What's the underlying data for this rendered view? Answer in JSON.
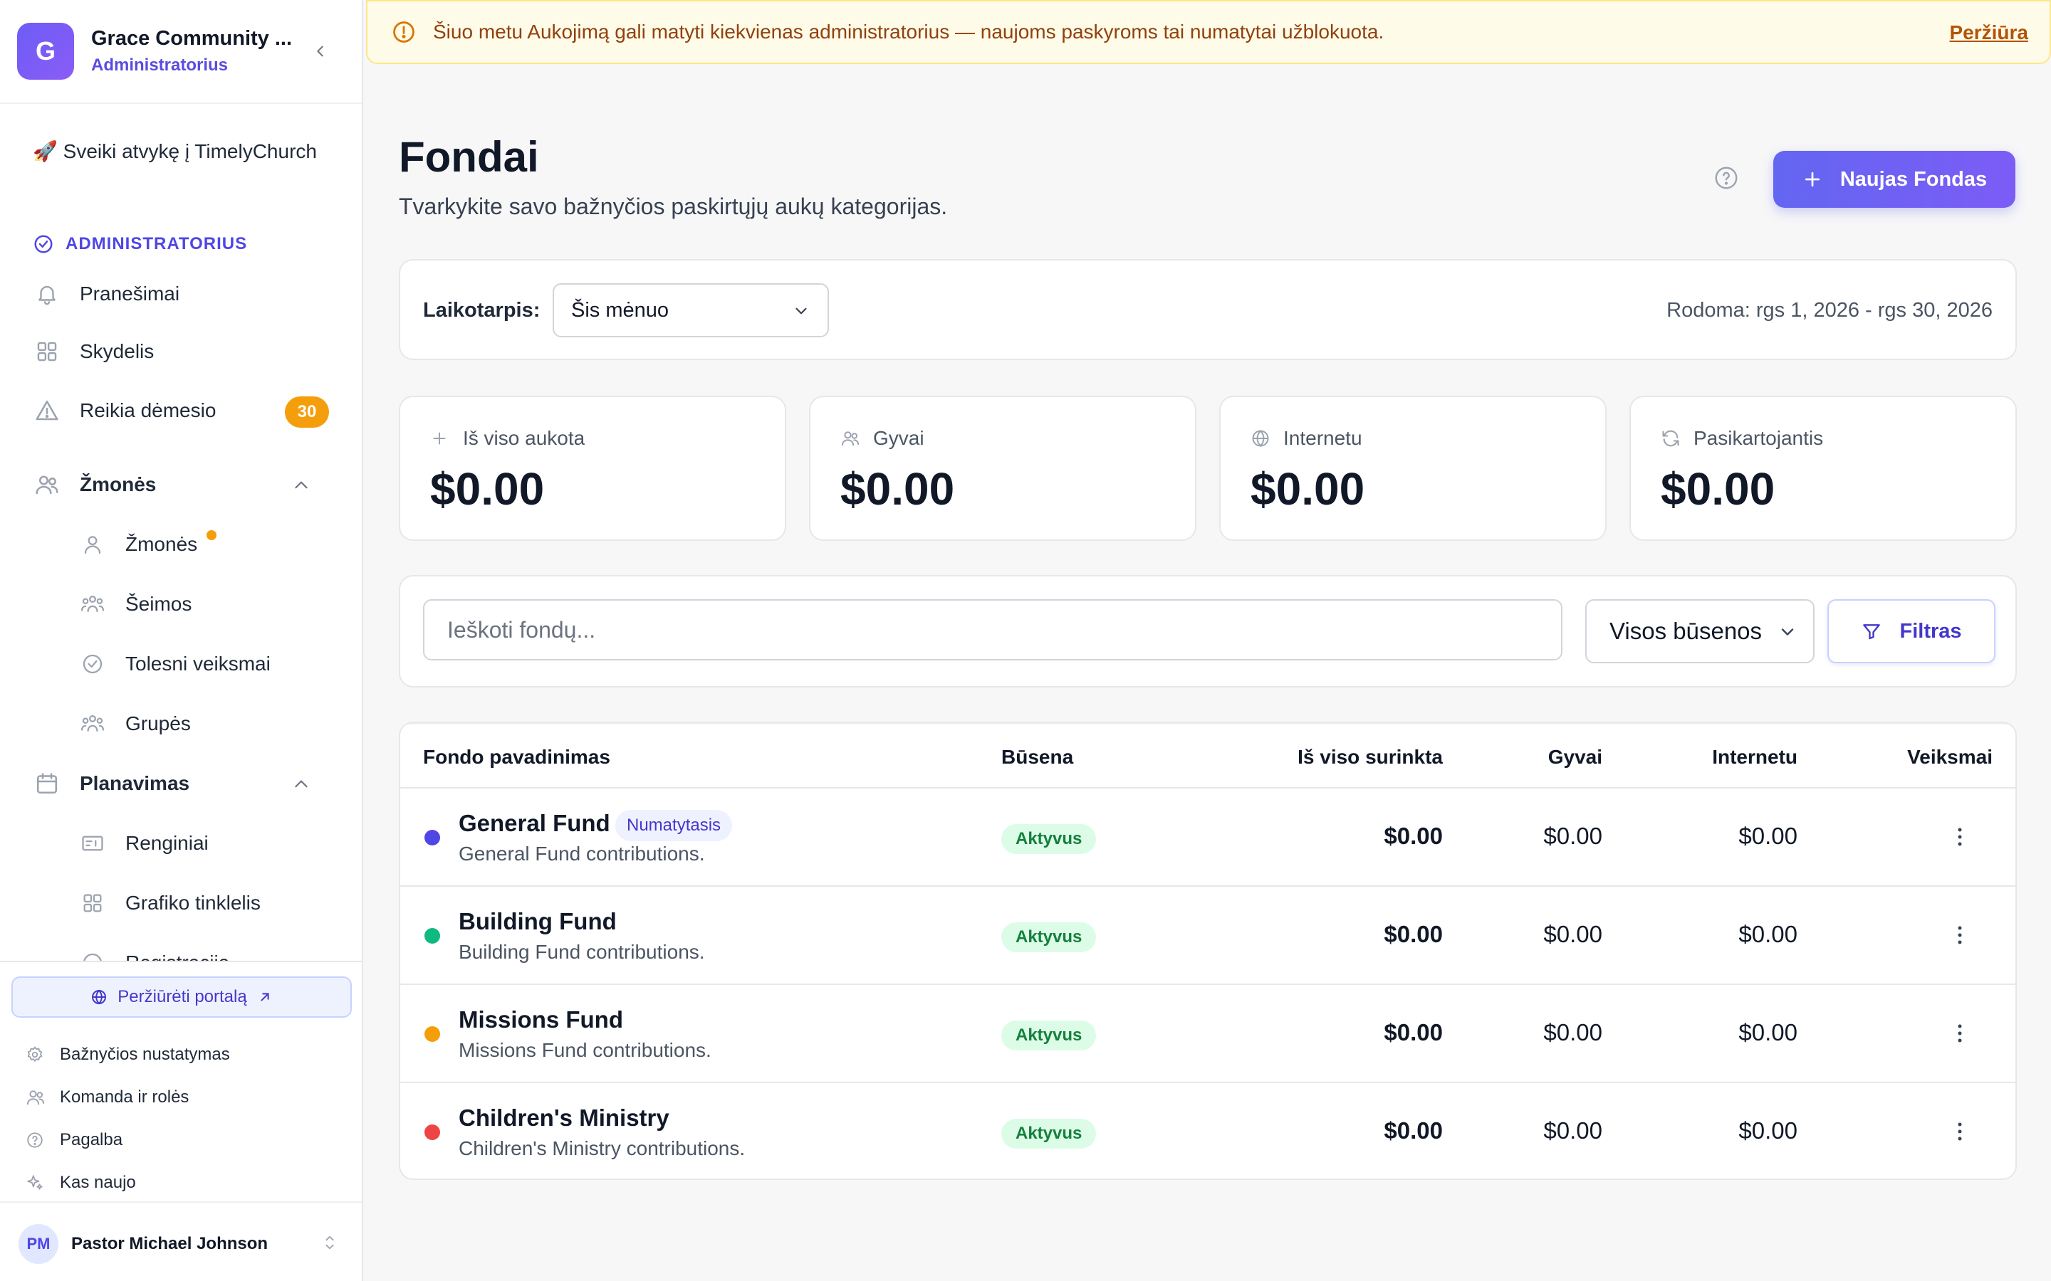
{
  "org": {
    "initial": "G",
    "name": "Grace Community ...",
    "role": "Administratorius"
  },
  "welcome": "🚀 Sveiki atvykę į TimelyChurch",
  "sidebar": {
    "section_admin": "ADMINISTRATORIUS",
    "items": [
      {
        "label": "Pranešimai"
      },
      {
        "label": "Skydelis"
      },
      {
        "label": "Reikia dėmesio",
        "badge": "30"
      },
      {
        "label": "Žmonės"
      },
      {
        "label": "Žmonės"
      },
      {
        "label": "Šeimos"
      },
      {
        "label": "Tolesni veiksmai"
      },
      {
        "label": "Grupės"
      },
      {
        "label": "Planavimas"
      },
      {
        "label": "Renginiai"
      },
      {
        "label": "Grafiko tinklelis"
      },
      {
        "label": "Registracija"
      }
    ],
    "portal_button": "Peržiūrėti portalą",
    "links": [
      {
        "label": "Bažnyčios nustatymas"
      },
      {
        "label": "Komanda ir rolės"
      },
      {
        "label": "Pagalba"
      },
      {
        "label": "Kas naujo"
      }
    ],
    "user": {
      "initials": "PM",
      "name": "Pastor Michael Johnson"
    }
  },
  "banner": {
    "text": "Šiuo metu Aukojimą gali matyti kiekvienas administratorius — naujoms paskyroms tai numatytai užblokuota.",
    "link": "Peržiūra"
  },
  "page": {
    "title": "Fondai",
    "subtitle": "Tvarkykite savo bažnyčios paskirtųjų aukų kategorijas.",
    "new_button": "Naujas Fondas"
  },
  "period": {
    "label": "Laikotarpis:",
    "selected": "Šis mėnuo",
    "range": "Rodoma: rgs 1, 2026 - rgs 30, 2026"
  },
  "stats": [
    {
      "label": "Iš viso aukota",
      "value": "$0.00",
      "icon": "plus-icon"
    },
    {
      "label": "Gyvai",
      "value": "$0.00",
      "icon": "users-icon"
    },
    {
      "label": "Internetu",
      "value": "$0.00",
      "icon": "globe-icon"
    },
    {
      "label": "Pasikartojantis",
      "value": "$0.00",
      "icon": "refresh-icon"
    }
  ],
  "search": {
    "placeholder": "Ieškoti fondų...",
    "status_select": "Visos būsenos",
    "filter_button": "Filtras"
  },
  "table": {
    "headers": {
      "name": "Fondo pavadinimas",
      "status": "Būsena",
      "total": "Iš viso surinkta",
      "live": "Gyvai",
      "online": "Internetu",
      "actions": "Veiksmai"
    },
    "rows": [
      {
        "name": "General Fund",
        "desc": "General Fund contributions.",
        "badge": "Numatytasis",
        "status": "Aktyvus",
        "total": "$0.00",
        "live": "$0.00",
        "online": "$0.00",
        "color": "#4f46e5"
      },
      {
        "name": "Building Fund",
        "desc": "Building Fund contributions.",
        "status": "Aktyvus",
        "total": "$0.00",
        "live": "$0.00",
        "online": "$0.00",
        "color": "#10b981"
      },
      {
        "name": "Missions Fund",
        "desc": "Missions Fund contributions.",
        "status": "Aktyvus",
        "total": "$0.00",
        "live": "$0.00",
        "online": "$0.00",
        "color": "#f59e0b"
      },
      {
        "name": "Children's Ministry",
        "desc": "Children's Ministry contributions.",
        "status": "Aktyvus",
        "total": "$0.00",
        "live": "$0.00",
        "online": "$0.00",
        "color": "#ef4444"
      }
    ]
  }
}
